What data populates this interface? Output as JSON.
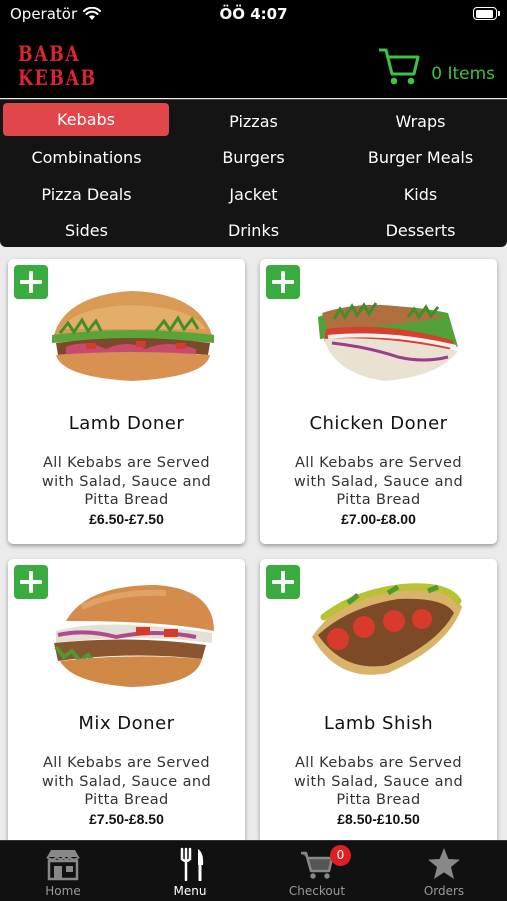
{
  "status_bar": {
    "carrier": "Operatör",
    "time": "ÖÖ 4:07"
  },
  "header": {
    "logo_line1": "BABA",
    "logo_line2": "KEBAB",
    "cart_label": "0 Items"
  },
  "categories": [
    {
      "label": "Kebabs",
      "active": true
    },
    {
      "label": "Pizzas"
    },
    {
      "label": "Wraps"
    },
    {
      "label": "Combinations"
    },
    {
      "label": "Burgers"
    },
    {
      "label": "Burger Meals"
    },
    {
      "label": "Pizza Deals"
    },
    {
      "label": "Jacket"
    },
    {
      "label": "Kids"
    },
    {
      "label": "Sides"
    },
    {
      "label": "Drinks"
    },
    {
      "label": "Desserts"
    }
  ],
  "products": [
    {
      "name": "Lamb Doner",
      "description": "All Kebabs are Served with Salad, Sauce and Pitta Bread",
      "price": "£6.50-£7.50"
    },
    {
      "name": "Chicken Doner",
      "description": "All Kebabs are Served with Salad, Sauce and Pitta Bread",
      "price": "£7.00-£8.00"
    },
    {
      "name": "Mix Doner",
      "description": "All Kebabs are Served with Salad, Sauce and Pitta Bread",
      "price": "£7.50-£8.50"
    },
    {
      "name": "Lamb Shish",
      "description": "All Kebabs are Served with Salad, Sauce and Pitta Bread",
      "price": "£8.50-£10.50"
    }
  ],
  "tab_bar": {
    "home": "Home",
    "menu": "Menu",
    "checkout": "Checkout",
    "orders": "Orders",
    "checkout_badge": "0"
  },
  "colors": {
    "accent_red": "#e0464a",
    "brand_green": "#3ec43e",
    "add_green": "#3aab3f"
  }
}
